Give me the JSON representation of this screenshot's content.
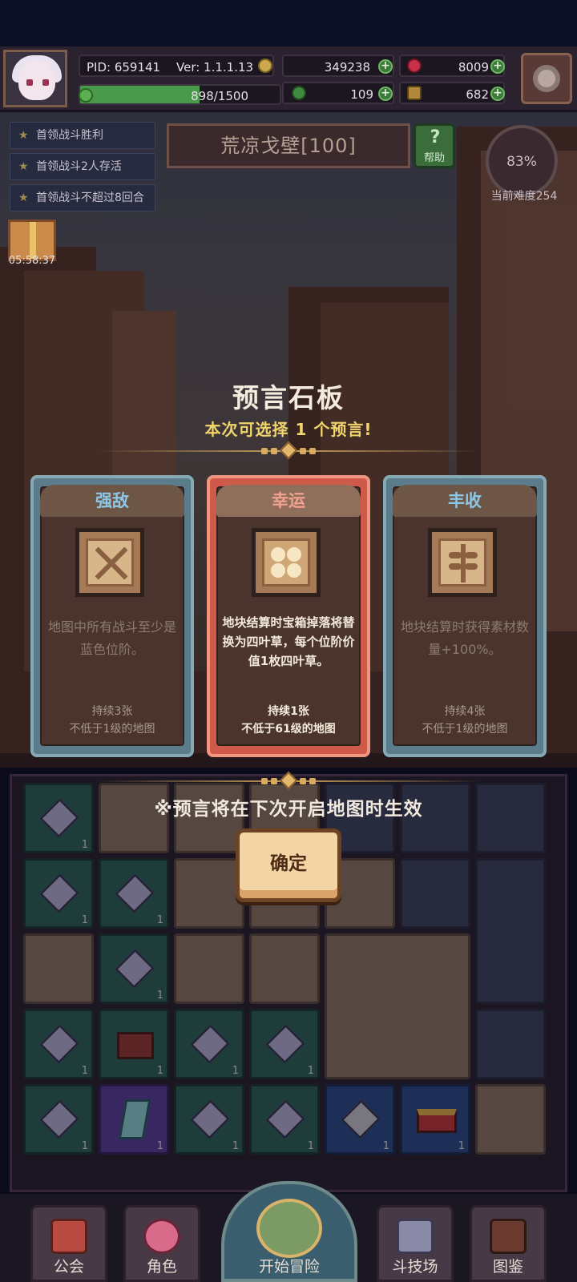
{
  "hud": {
    "pid": "PID: 659141",
    "version": "Ver: 1.1.1.13",
    "gold": "349238",
    "gems": "8009",
    "clovers": "109",
    "materials": "682",
    "xp": "898/1500",
    "xp_fraction": 0.5987
  },
  "quests": [
    "首领战斗胜利",
    "首领战斗2人存活",
    "首领战斗不超过8回合"
  ],
  "gift_timer": "05:58:37",
  "map": {
    "title": "荒凉戈壁[100]",
    "help_label": "帮助"
  },
  "difficulty": {
    "percent": "83%",
    "label": "当前难度254"
  },
  "modal": {
    "title": "预言石板",
    "subtitle": "本次可选择 1 个预言!",
    "effect_note": "※预言将在下次开启地图时生效",
    "confirm_label": "确定",
    "cards": [
      {
        "name": "强敌",
        "description": "地图中所有战斗至少是蓝色位阶。",
        "duration": "持续3张",
        "requirement": "不低于1级的地图",
        "icon": "crossed-swords-icon",
        "selected": false
      },
      {
        "name": "幸运",
        "description": "地块结算时宝箱掉落将替换为四叶草，每个位阶价值1枚四叶草。",
        "duration": "持续1张",
        "requirement": "不低于61级的地图",
        "icon": "four-leaf-clover-icon",
        "selected": true
      },
      {
        "name": "丰收",
        "description": "地块结算时获得素材数量+100%。",
        "duration": "持续4张",
        "requirement": "不低于1级的地图",
        "icon": "harvest-wheat-icon",
        "selected": false
      }
    ]
  },
  "inventory_qty": "1",
  "nav": {
    "guild": "公会",
    "character": "角色",
    "adventure": "开始冒险",
    "arena": "斗技场",
    "codex": "图鉴"
  },
  "colors": {
    "accent_gold": "#f2d46c",
    "selected_card": "#cf5a4a",
    "unselected_card": "#5b7c8a"
  }
}
